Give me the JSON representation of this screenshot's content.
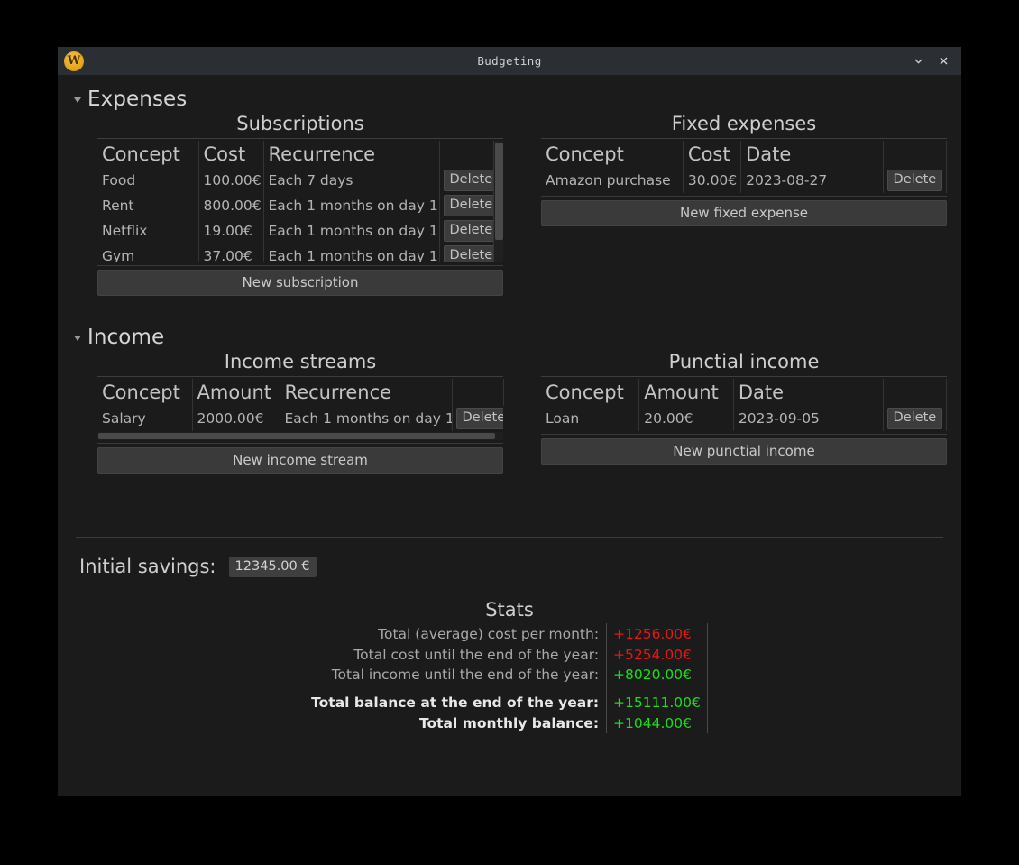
{
  "window": {
    "title": "Budgeting",
    "logo_glyph": "W",
    "minimize_icon": "⌄",
    "close_icon": "✕"
  },
  "expenses": {
    "section_label": "Expenses",
    "subscriptions": {
      "title": "Subscriptions",
      "columns": [
        "Concept",
        "Cost",
        "Recurrence",
        ""
      ],
      "rows": [
        {
          "concept": "Food",
          "cost": "100.00€",
          "recurrence": "Each 7 days",
          "action": "Delete"
        },
        {
          "concept": "Rent",
          "cost": "800.00€",
          "recurrence": "Each 1 months on day 1",
          "action": "Delete"
        },
        {
          "concept": "Netflix",
          "cost": "19.00€",
          "recurrence": "Each 1 months on day 1",
          "action": "Delete"
        },
        {
          "concept": "Gym",
          "cost": "37.00€",
          "recurrence": "Each 1 months on day 1",
          "action": "Delete"
        }
      ],
      "new_button": "New subscription"
    },
    "fixed": {
      "title": "Fixed expenses",
      "columns": [
        "Concept",
        "Cost",
        "Date",
        ""
      ],
      "rows": [
        {
          "concept": "Amazon purchase",
          "cost": "30.00€",
          "date": "2023-08-27",
          "action": "Delete"
        }
      ],
      "new_button": "New fixed expense"
    }
  },
  "income": {
    "section_label": "Income",
    "streams": {
      "title": "Income streams",
      "columns": [
        "Concept",
        "Amount",
        "Recurrence",
        ""
      ],
      "rows": [
        {
          "concept": "Salary",
          "amount": "2000.00€",
          "recurrence": "Each 1 months on day 1",
          "action": "Delete"
        }
      ],
      "new_button": "New income stream"
    },
    "punctual": {
      "title": "Punctial income",
      "columns": [
        "Concept",
        "Amount",
        "Date",
        ""
      ],
      "rows": [
        {
          "concept": "Loan",
          "amount": "20.00€",
          "date": "2023-09-05",
          "action": "Delete"
        }
      ],
      "new_button": "New punctial income"
    }
  },
  "savings": {
    "label": "Initial savings:",
    "value": "12345.00 €"
  },
  "stats": {
    "title": "Stats",
    "rows": [
      {
        "label": "Total (average) cost per month:",
        "value": "+1256.00€",
        "tone": "neg",
        "bold": false
      },
      {
        "label": "Total cost until the end of the year:",
        "value": "+5254.00€",
        "tone": "neg",
        "bold": false
      },
      {
        "label": "Total income until the end of the year:",
        "value": "+8020.00€",
        "tone": "pos",
        "bold": false
      }
    ],
    "totals": [
      {
        "label": "Total balance at the end of the year:",
        "value": "+15111.00€",
        "tone": "pos",
        "bold": true
      },
      {
        "label": "Total monthly balance:",
        "value": "+1044.00€",
        "tone": "pos",
        "bold": true
      }
    ]
  },
  "colors": {
    "positive": "#18e018",
    "negative": "#e81414",
    "window_bg": "#1b1b1b",
    "titlebar_bg": "#2b2f33",
    "accent_logo": "#e3a71f"
  }
}
